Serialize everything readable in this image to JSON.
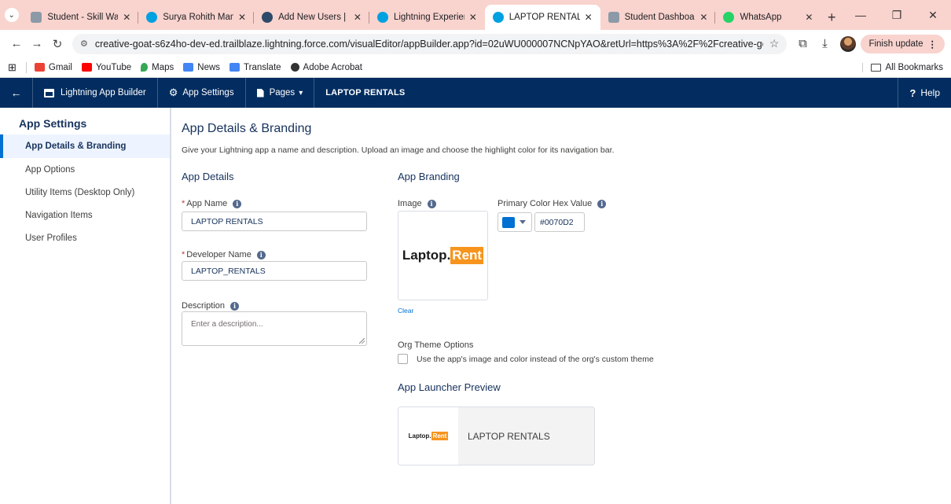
{
  "browser": {
    "tabs": [
      {
        "title": "Student - Skill Wallet",
        "icon_color": "#8c9aa8"
      },
      {
        "title": "Surya Rohith Manga",
        "icon_color": "#00a1e0"
      },
      {
        "title": "Add New Users | Sale",
        "icon_color": "#2e4a6b"
      },
      {
        "title": "Lightning Experience",
        "icon_color": "#00a1e0"
      },
      {
        "title": "LAPTOP RENTALS - L",
        "icon_color": "#00a1e0"
      },
      {
        "title": "Student Dashboard",
        "icon_color": "#8c9aa8"
      },
      {
        "title": "WhatsApp",
        "icon_color": "#25d366"
      }
    ],
    "url": "creative-goat-s6z4ho-dev-ed.trailblaze.lightning.force.com/visualEditor/appBuilder.app?id=02uWU000007NCNpYAO&retUrl=https%3A%2F%2Fcreative-goat-s6z4ho-dev-e...",
    "finish_update": "Finish update",
    "bookmarks": [
      {
        "label": "Gmail",
        "icon_color": "#ea4335"
      },
      {
        "label": "YouTube",
        "icon_color": "#ff0000"
      },
      {
        "label": "Maps",
        "icon_color": "#34a853"
      },
      {
        "label": "News",
        "icon_color": "#4285f4"
      },
      {
        "label": "Translate",
        "icon_color": "#4285f4"
      },
      {
        "label": "Adobe Acrobat",
        "icon_color": "#333333"
      }
    ],
    "all_bookmarks": "All Bookmarks",
    "tab_bar_color": "#f9d3ce"
  },
  "appbar": {
    "builder": "Lightning App Builder",
    "settings": "App Settings",
    "pages": "Pages",
    "app_name": "LAPTOP RENTALS",
    "help": "Help",
    "color": "#032d60"
  },
  "sidebar": {
    "heading": "App Settings",
    "items": [
      "App Details & Branding",
      "App Options",
      "Utility Items (Desktop Only)",
      "Navigation Items",
      "User Profiles"
    ]
  },
  "main": {
    "title": "App Details & Branding",
    "description": "Give your Lightning app a name and description. Upload an image and choose the highlight color for its navigation bar.",
    "app_details": {
      "heading": "App Details",
      "app_name_label": "App Name",
      "app_name_value": "LAPTOP RENTALS",
      "dev_name_label": "Developer Name",
      "dev_name_value": "LAPTOP_RENTALS",
      "desc_label": "Description",
      "desc_placeholder": "Enter a description..."
    },
    "branding": {
      "heading": "App Branding",
      "image_label": "Image",
      "logo_left": "Laptop",
      "logo_dot": ".",
      "logo_right": "Rent",
      "clear": "Clear",
      "color_label": "Primary Color Hex Value",
      "color_value": "#0070D2",
      "theme_label": "Org Theme Options",
      "theme_checkbox": "Use the app's image and color instead of the org's custom theme",
      "launcher_heading": "App Launcher Preview",
      "launcher_name": "LAPTOP RENTALS"
    }
  }
}
